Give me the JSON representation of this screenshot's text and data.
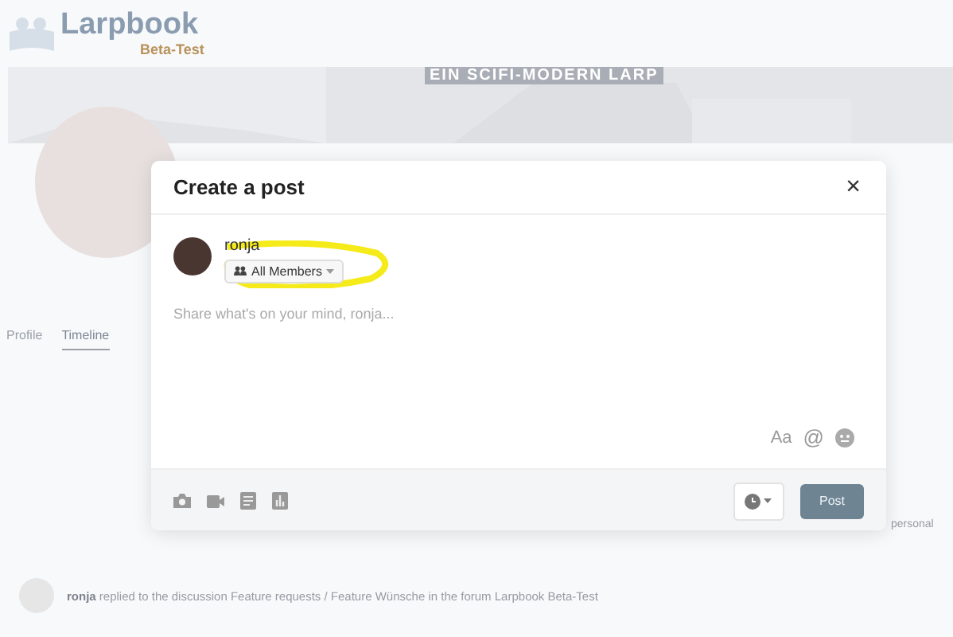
{
  "site": {
    "logo": "Larpbook",
    "tagline": "Beta-Test",
    "banner_title": "EIN SCIFI-MODERN LARP"
  },
  "profile_tabs": [
    {
      "label": "Profile",
      "selected": false
    },
    {
      "label": "Timeline",
      "selected": true
    }
  ],
  "activity": {
    "text": "**ronja** replied to the discussion Feature requests / Feature Wünsche in the forum Larpbook Beta-Test"
  },
  "side_note": "personal",
  "modal": {
    "title": "Create a post",
    "close": "×",
    "author": "ronja",
    "audience": "All Members",
    "placeholder": "Share what's on your mind, ronja...",
    "format_label": "Aa",
    "mention": "@",
    "submit": "Post",
    "highlighted": true
  }
}
